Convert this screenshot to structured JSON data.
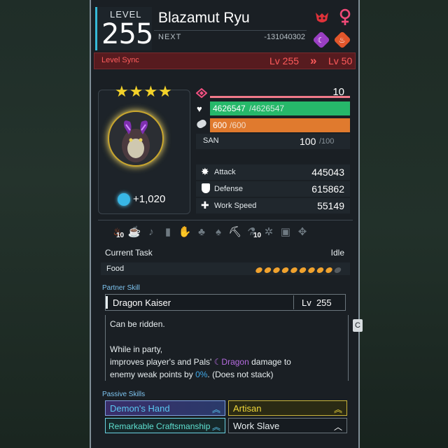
{
  "header": {
    "level_word": "LEVEL",
    "level": "255",
    "name": "Blazamut Ryu",
    "next_label": "NEXT",
    "next_value": "-131040302",
    "gender_icon": "female-icon",
    "element_icons": [
      "dragon-element-icon",
      "fire-element-icon"
    ],
    "colors": {
      "accent": "#35b9d8",
      "dragon": "#9b3fc4",
      "fire": "#e2562b",
      "boss": "#e0323a"
    }
  },
  "level_sync": {
    "label": "Level Sync",
    "from": "Lv 255",
    "to": "Lv 50"
  },
  "portrait": {
    "stars": "★★★★",
    "soul_bonus": "+1,020"
  },
  "stats": {
    "trust_value": "10",
    "hp": {
      "current": "4626547",
      "max": "/4626547",
      "fraction": 1.0
    },
    "stamina": {
      "current": "600",
      "max": "/600",
      "fraction": 1.0
    },
    "san": {
      "label": "SAN",
      "current": "100",
      "max": "/100"
    },
    "attack": {
      "label": "Attack",
      "value": "445043"
    },
    "defense": {
      "label": "Defense",
      "value": "615862"
    },
    "work_speed": {
      "label": "Work Speed",
      "value": "55149"
    }
  },
  "work": {
    "kindling_level": "10",
    "mining_level": "10",
    "current_task_label": "Current Task",
    "current_task_value": "Idle",
    "food_label": "Food",
    "food_full": 9,
    "food_total": 10
  },
  "partner_skill": {
    "section_label": "Partner Skill",
    "name": "Dragon Kaiser",
    "level": "Lv  255",
    "desc_line1": "Can be ridden.",
    "desc_line2": "While in party,",
    "desc_line3a": "improves player's and Pals' ",
    "desc_element": "Dragon",
    "desc_line3b": " damage to",
    "desc_line4a": "enemy weak points by ",
    "desc_pct": "0%",
    "desc_line4b": ". (Does not stack)",
    "side_tab": "C"
  },
  "passive_skills": {
    "section_label": "Passive Skills",
    "items": [
      "Demon's Hand",
      "Artisan",
      "Remarkable Craftsmanship",
      "Work Slave"
    ]
  }
}
